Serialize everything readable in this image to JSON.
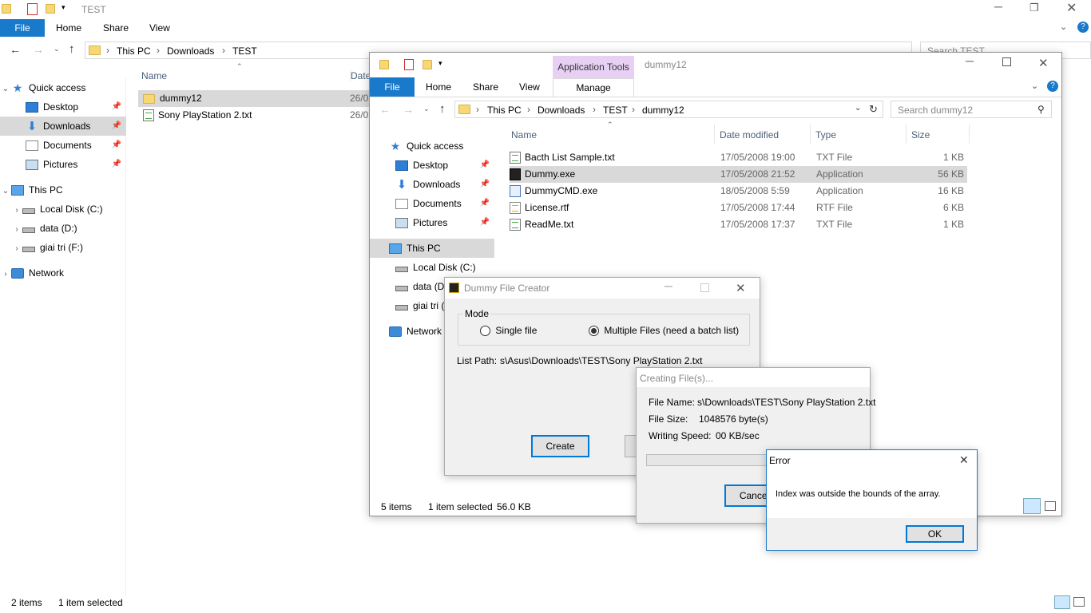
{
  "bg": {
    "title": "TEST",
    "tabs": [
      "File",
      "Home",
      "Share",
      "View"
    ],
    "breadcrumb": [
      "This PC",
      "Downloads",
      "TEST"
    ],
    "search_placeholder": "Search TEST",
    "nav": {
      "quick_access": "Quick access",
      "desktop": "Desktop",
      "downloads": "Downloads",
      "documents": "Documents",
      "pictures": "Pictures",
      "this_pc": "This PC",
      "local_disk": "Local Disk (C:)",
      "data": "data (D:)",
      "giai_tri": "giai tri (F:)",
      "network": "Network"
    },
    "col_name": "Name",
    "col_date": "Date",
    "files": [
      {
        "name": "dummy12",
        "date": "26/0"
      },
      {
        "name": "Sony PlayStation 2.txt",
        "date": "26/0"
      }
    ],
    "status_items": "2 items",
    "status_selected": "1 item selected"
  },
  "fg": {
    "context_tab": "Application Tools",
    "title": "dummy12",
    "tabs": {
      "file": "File",
      "home": "Home",
      "share": "Share",
      "view": "View",
      "manage": "Manage"
    },
    "breadcrumb": [
      "This PC",
      "Downloads",
      "TEST",
      "dummy12"
    ],
    "search_placeholder": "Search dummy12",
    "nav": {
      "quick_access": "Quick access",
      "desktop": "Desktop",
      "downloads": "Downloads",
      "documents": "Documents",
      "pictures": "Pictures",
      "this_pc": "This PC",
      "local_disk": "Local Disk (C:)",
      "data": "data (D:",
      "giai_tri": "giai tri (",
      "network": "Network"
    },
    "columns": {
      "name": "Name",
      "date": "Date modified",
      "type": "Type",
      "size": "Size"
    },
    "files": [
      {
        "name": "Bacth List Sample.txt",
        "date": "17/05/2008 19:00",
        "type": "TXT File",
        "size": "1 KB"
      },
      {
        "name": "Dummy.exe",
        "date": "17/05/2008 21:52",
        "type": "Application",
        "size": "56 KB"
      },
      {
        "name": "DummyCMD.exe",
        "date": "18/05/2008 5:59",
        "type": "Application",
        "size": "16 KB"
      },
      {
        "name": "License.rtf",
        "date": "17/05/2008 17:44",
        "type": "RTF File",
        "size": "6 KB"
      },
      {
        "name": "ReadMe.txt",
        "date": "17/05/2008 17:37",
        "type": "TXT File",
        "size": "1 KB"
      }
    ],
    "status_items": "5 items",
    "status_selected": "1 item selected",
    "status_size": "56.0 KB"
  },
  "dfc": {
    "title": "Dummy File Creator",
    "mode_label": "Mode",
    "single": "Single file",
    "multiple": "Multiple Files (need a batch list)",
    "list_path_label": "List Path:",
    "list_path_value": "s\\Asus\\Downloads\\TEST\\Sony PlayStation 2.txt",
    "create": "Create"
  },
  "creating": {
    "title": "Creating File(s)...",
    "file_name_label": "File Name:",
    "file_name_value": "s\\Downloads\\TEST\\Sony PlayStation 2.txt",
    "file_size_label": "File Size:",
    "file_size_value": "1048576 byte(s)",
    "speed_label": "Writing Speed:",
    "speed_value": "00 KB/sec",
    "cancel": "Cancel",
    "progress": 0
  },
  "error": {
    "title": "Error",
    "message": "Index was outside the bounds of the array.",
    "ok": "OK"
  },
  "colors": {
    "accent": "#0078d7",
    "selected": "#cce8ff",
    "context_tab": "#e8d0f5"
  }
}
